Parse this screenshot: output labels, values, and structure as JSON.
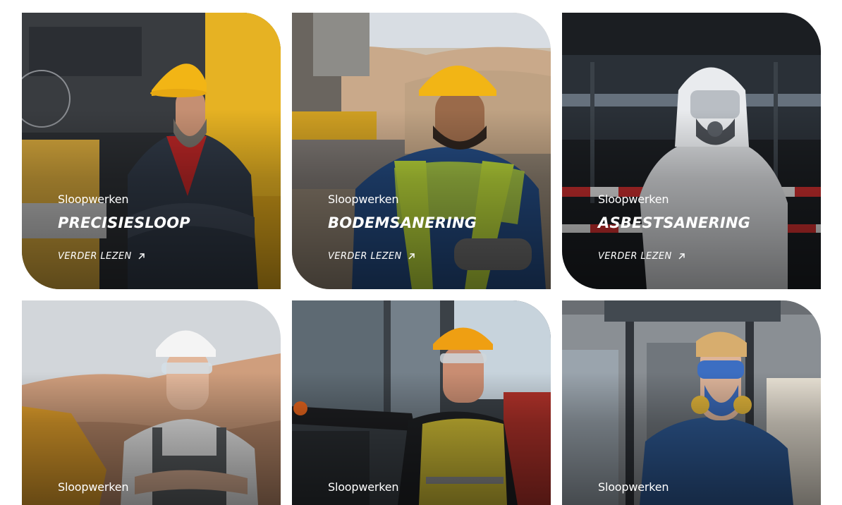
{
  "cards": [
    {
      "category": "Sloopwerken",
      "title": "PRECISIESLOOP",
      "link_label": "VERDER LEZEN",
      "link_icon": "arrow-up-right-icon"
    },
    {
      "category": "Sloopwerken",
      "title": "BODEMSANERING",
      "link_label": "VERDER LEZEN",
      "link_icon": "arrow-up-right-icon"
    },
    {
      "category": "Sloopwerken",
      "title": "ASBESTSANERING",
      "link_label": "VERDER LEZEN",
      "link_icon": "arrow-up-right-icon"
    },
    {
      "category": "Sloopwerken"
    },
    {
      "category": "Sloopwerken"
    },
    {
      "category": "Sloopwerken"
    }
  ],
  "colors": {
    "text": "#ffffff",
    "page_background": "#ffffff",
    "hardhat_yellow": "#f2b515",
    "excavator_yellow": "#e9b020",
    "safety_vest_green": "#b9d63a",
    "coverall_blue": "#2f5b97"
  }
}
